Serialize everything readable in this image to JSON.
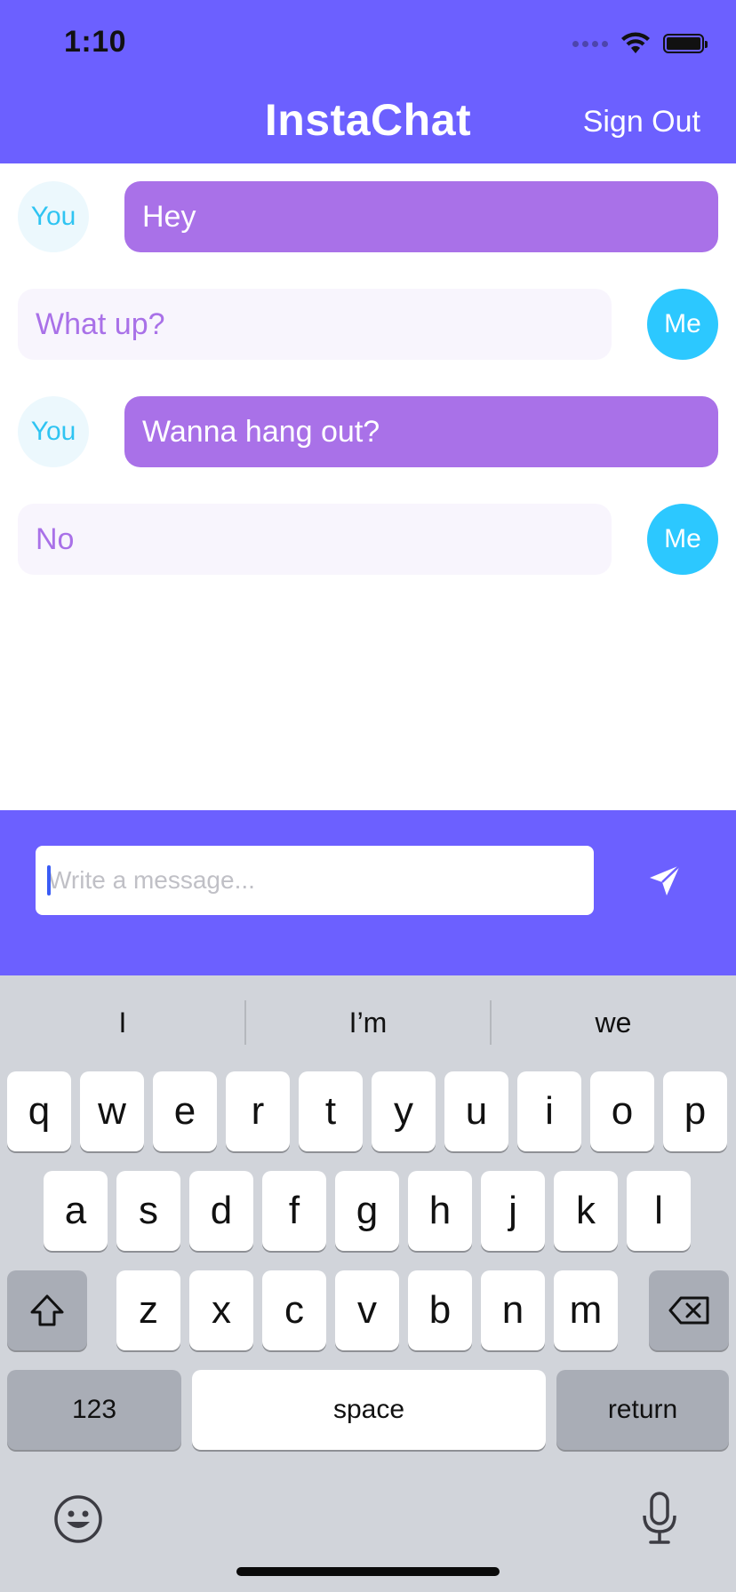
{
  "status_bar": {
    "time": "1:10"
  },
  "header": {
    "title": "InstaChat",
    "sign_out_label": "Sign Out",
    "background_color": "#6c60ff"
  },
  "messages": [
    {
      "sender": "You",
      "text": "Hey"
    },
    {
      "sender": "Me",
      "text": "What up?"
    },
    {
      "sender": "You",
      "text": "Wanna hang out?"
    },
    {
      "sender": "Me",
      "text": "No"
    }
  ],
  "composer": {
    "placeholder": "Write a message...",
    "value": "",
    "send_icon": "paper-plane-icon"
  },
  "keyboard": {
    "suggestions": [
      "I",
      "I’m",
      "we"
    ],
    "rows": [
      [
        "q",
        "w",
        "e",
        "r",
        "t",
        "y",
        "u",
        "i",
        "o",
        "p"
      ],
      [
        "a",
        "s",
        "d",
        "f",
        "g",
        "h",
        "j",
        "k",
        "l"
      ],
      [
        "z",
        "x",
        "c",
        "v",
        "b",
        "n",
        "m"
      ]
    ],
    "shift_icon": "shift-icon",
    "delete_icon": "delete-icon",
    "numbers_label": "123",
    "space_label": "space",
    "return_label": "return",
    "emoji_icon": "emoji-icon",
    "mic_icon": "microphone-icon"
  },
  "colors": {
    "accent": "#6c60ff",
    "incoming_bubble": "#a971e8",
    "outgoing_bubble": "#f8f5fd",
    "me_avatar": "#2cc8ff",
    "you_avatar": "#ecf8fd"
  }
}
